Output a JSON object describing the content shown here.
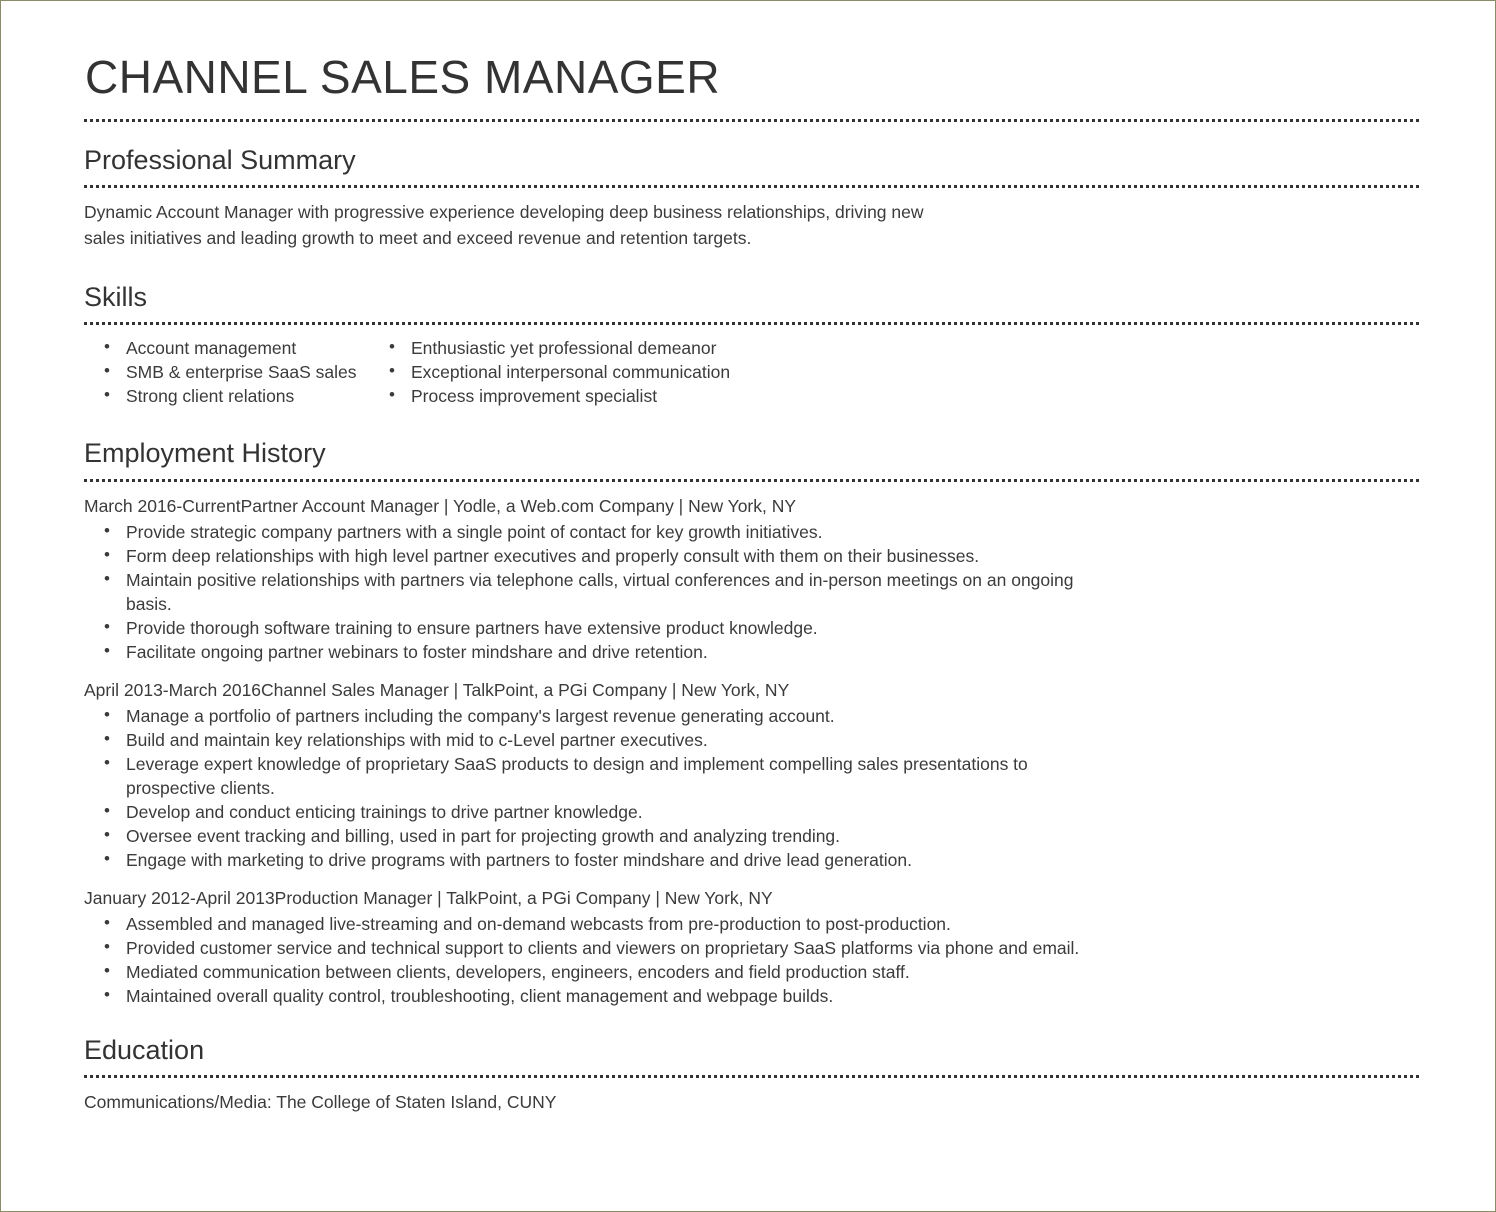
{
  "document": {
    "title": "CHANNEL SALES MANAGER",
    "border_color": "#8b8b66",
    "text_color": "#3b3b3b",
    "heading_color": "#333333"
  },
  "sections": {
    "summary": {
      "heading": "Professional Summary",
      "line1": "Dynamic Account Manager with progressive experience developing deep business relationships, driving new",
      "line2": "sales initiatives and leading growth to meet and exceed revenue and retention targets."
    },
    "skills": {
      "heading": "Skills",
      "column_1": [
        "Account management",
        "SMB & enterprise SaaS sales",
        "Strong client relations"
      ],
      "column_2": [
        "Enthusiastic yet professional demeanor",
        "Exceptional interpersonal communication",
        "Process improvement specialist"
      ]
    },
    "employment": {
      "heading": "Employment History",
      "jobs": [
        {
          "heading": "March 2016-CurrentPartner Account Manager | Yodle, a Web.com Company | New York, NY",
          "bullets": [
            "Provide strategic company partners with a single point of contact for key growth initiatives.",
            "Form deep relationships with high level partner executives and properly consult with them on their businesses.",
            "Maintain positive relationships with partners via telephone calls, virtual conferences and in-person meetings on an ongoing basis.",
            "Provide thorough software training to ensure partners have extensive product knowledge.",
            "Facilitate ongoing partner webinars to foster mindshare and drive retention."
          ]
        },
        {
          "heading": "April 2013-March 2016Channel Sales Manager | TalkPoint, a PGi Company | New York, NY",
          "bullets": [
            "Manage a portfolio of partners including the company's largest revenue generating account.",
            "Build and maintain key relationships with mid to c-Level partner executives.",
            "Leverage expert knowledge of proprietary SaaS products to design and implement compelling sales presentations to prospective clients.",
            "Develop and conduct enticing trainings to drive partner knowledge.",
            "Oversee event tracking and billing, used in part for projecting growth and analyzing trending.",
            "Engage with marketing to drive programs with partners to foster mindshare and drive lead generation."
          ]
        },
        {
          "heading": "January 2012-April 2013Production Manager | TalkPoint, a PGi Company | New York, NY",
          "bullets": [
            "Assembled and managed live-streaming and on-demand webcasts from pre-production to post-production.",
            "Provided customer service and technical support to clients and viewers on proprietary SaaS platforms via phone and email.",
            "Mediated communication between clients, developers, engineers, encoders and field production staff.",
            "Maintained overall quality control, troubleshooting, client management and webpage builds."
          ]
        }
      ]
    },
    "education": {
      "heading": "Education",
      "entry": "Communications/Media: The College of Staten Island, CUNY"
    }
  }
}
